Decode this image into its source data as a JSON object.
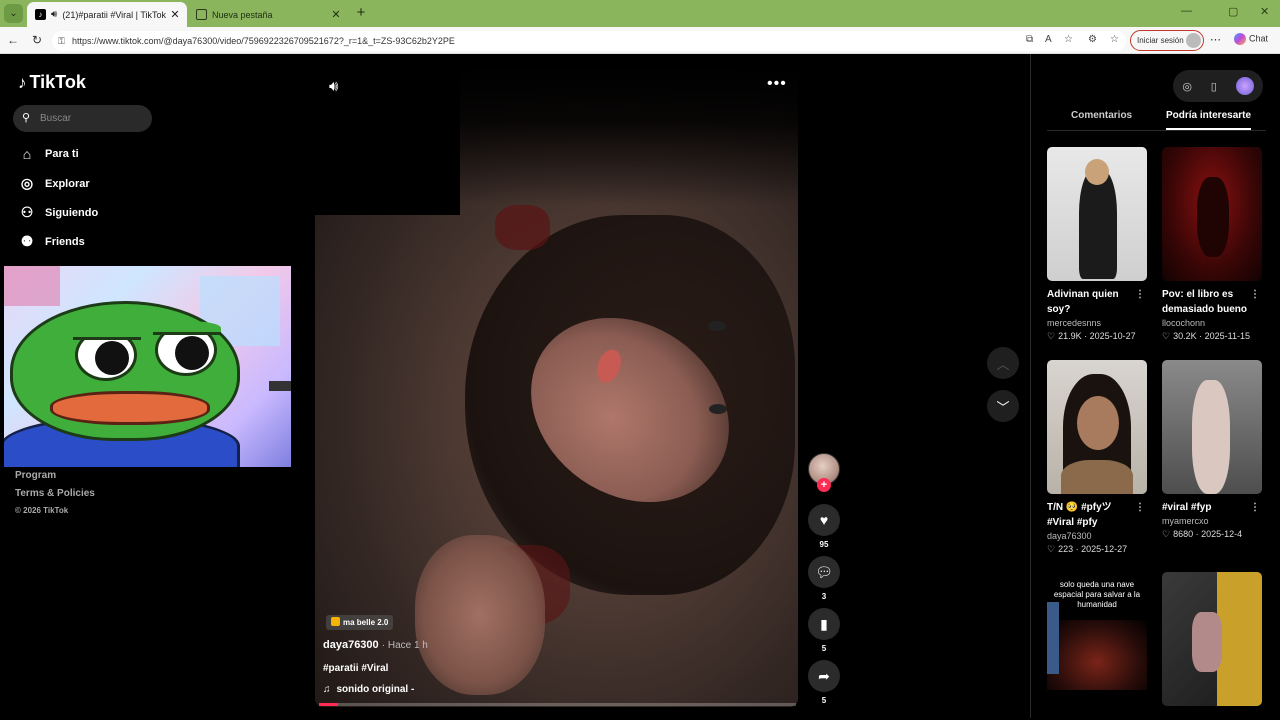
{
  "browser": {
    "tabs": [
      {
        "title": "(21)#paratii #Viral | TikTok",
        "active": true
      },
      {
        "title": "Nueva pestaña",
        "active": false
      }
    ],
    "url": "https://www.tiktok.com/@daya76300/video/7596922326709521672?_r=1&_t=ZS-93C62b2Y2PE",
    "signin_label": "Iniciar sesión",
    "chat_label": "Chat"
  },
  "sidebar": {
    "logo": "TikTok",
    "search_placeholder": "Buscar",
    "nav": [
      {
        "label": "Para ti",
        "icon": "home-icon"
      },
      {
        "label": "Explorar",
        "icon": "compass-icon"
      },
      {
        "label": "Siguiendo",
        "icon": "following-icon"
      },
      {
        "label": "Friends",
        "icon": "friends-icon"
      }
    ],
    "footer_links": [
      "Program",
      "Terms & Policies"
    ],
    "copyright": "© 2026 TikTok"
  },
  "video": {
    "music_badge": "ma belle 2.0",
    "author": "daya76300",
    "time": "· Hace 1 h",
    "hashtags": "#paratii #Viral",
    "sound": "sonido original -",
    "progress": 0.04
  },
  "actions": {
    "likes": "95",
    "comments": "3",
    "saves": "5",
    "shares": "5"
  },
  "right_panel": {
    "tabs": [
      "Comentarios",
      "Podría interesarte"
    ],
    "active_tab": "Podría interesarte",
    "cards": [
      {
        "title": "Adivinan quien soy?",
        "user": "mercedesnns",
        "likes": "21.9K",
        "date": "2025-10-27"
      },
      {
        "title": "Pov: el libro es demasiado bueno",
        "user": "llocochonn",
        "likes": "30.2K",
        "date": "2025-11-15"
      },
      {
        "title": "T/N 🥺 #pfyツ #Viral #pfy",
        "user": "daya76300",
        "likes": "223",
        "date": "2025-12-27"
      },
      {
        "title": "#viral #fyp",
        "user": "myamercxo",
        "likes": "8680",
        "date": "2025-12-4"
      }
    ],
    "card5_overlay": "solo queda una nave espacial para salvar a la humanidad"
  },
  "colors": {
    "tabstrip": "#8ab55c",
    "accent": "#fe2c55"
  }
}
